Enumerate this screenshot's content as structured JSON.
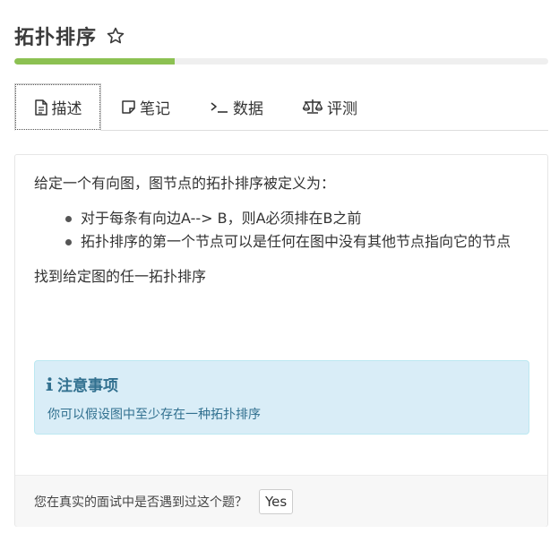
{
  "header": {
    "title": "拓扑排序",
    "progress_fraction": 0.3
  },
  "tabs": [
    {
      "label": "描述",
      "icon": "document-icon",
      "active": true
    },
    {
      "label": "笔记",
      "icon": "note-icon",
      "active": false
    },
    {
      "label": "数据",
      "icon": "terminal-icon",
      "active": false
    },
    {
      "label": "评测",
      "icon": "scale-icon",
      "active": false
    }
  ],
  "description": {
    "intro": "给定一个有向图，图节点的拓扑排序被定义为：",
    "bullets": [
      "对于每条有向边A--> B，则A必须排在B之前",
      "拓扑排序的第一个节点可以是任何在图中没有其他节点指向它的节点"
    ],
    "goal": "找到给定图的任一拓扑排序"
  },
  "notice": {
    "title": "注意事项",
    "text": "你可以假设图中至少存在一种拓扑排序",
    "icon": "info-icon"
  },
  "footer": {
    "question": "您在真实的面试中是否遇到过这个题？",
    "yes_label": "Yes"
  },
  "colors": {
    "progress": "#8cc152",
    "notice_bg": "#d9edf7",
    "notice_text": "#31708f"
  }
}
